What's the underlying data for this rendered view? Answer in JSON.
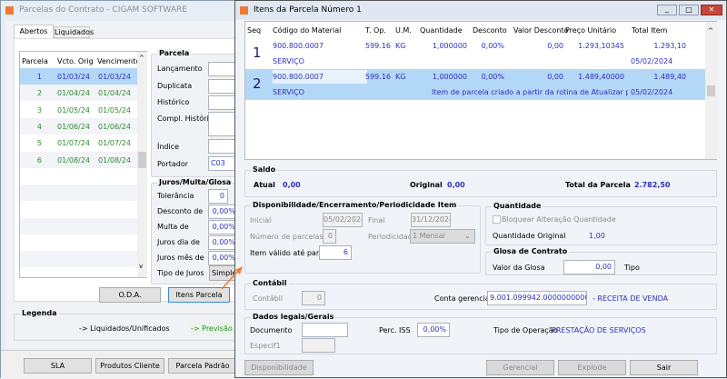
{
  "left_window": {
    "title": "Parcelas do Contrato - CIGAM SOFTWARE CORPORATIVO LTDA",
    "tabs": [
      "Abertos",
      "Liquidados"
    ],
    "table": {
      "headers": [
        "Parcela",
        "Vcto. Orig",
        "Vencimento"
      ],
      "rows": [
        [
          "1",
          "01/03/24",
          "01/03/24"
        ],
        [
          "2",
          "01/04/24",
          "01/04/24"
        ],
        [
          "3",
          "01/05/24",
          "01/05/24"
        ],
        [
          "4",
          "01/06/24",
          "01/06/24"
        ],
        [
          "5",
          "01/07/24",
          "01/07/24"
        ],
        [
          "6",
          "01/08/24",
          "01/08/24"
        ]
      ]
    },
    "parcela": {
      "title": "Parcela",
      "lancamento": "Lançamento",
      "duplicata": "Duplicata",
      "historico": "Histórico",
      "compl_historico": "Compl. Histórico",
      "indice": "Índice",
      "portador": "Portador",
      "portador_value": "C03"
    },
    "juros": {
      "title": "Juros/Multa/Glosa",
      "tolerancia": "Tolerância",
      "tolerancia_value": "0",
      "desconto": "Desconto de",
      "desconto_value": "0,00%",
      "multa": "Multa de",
      "multa_value": "0,00%",
      "juros_dia": "Juros dia de",
      "juros_dia_value": "0,00%",
      "juros_mes": "Juros mês de",
      "juros_mes_value": "0,00%",
      "tipo_juros": "Tipo de Juros",
      "tipo_juros_value": "Simples"
    },
    "oda_button": "O.D.A.",
    "itens_parcela_button": "Itens Parcela",
    "legenda": {
      "title": "Legenda",
      "liquidados": "-> Liquidados/Unificados",
      "previsao": "-> Previsão"
    },
    "bottom_buttons": [
      "SLA",
      "Produtos Cliente",
      "Parcela Padrão"
    ]
  },
  "right_window": {
    "title": "Itens da Parcela Número 1",
    "grid": {
      "headers": [
        "Seq",
        "Código do Material",
        "T. Op.",
        "U.M.",
        "Quantidade",
        "Desconto",
        "Valor Desconto",
        "Preço Unitário",
        "Total Item"
      ],
      "rows": [
        {
          "seq": "1",
          "codigo": "900.800.0007",
          "top": "599.16",
          "um": "KG",
          "quantidade": "1,000000",
          "desconto": "0,00%",
          "valor_desconto": "0,00",
          "preco": "1.293,10345",
          "total": "1.293,10",
          "descricao": "SERVIÇO",
          "obs": "",
          "data": "05/02/2024"
        },
        {
          "seq": "2",
          "codigo": "900.800.0007",
          "top": "599.16",
          "um": "KG",
          "quantidade": "1,000000",
          "desconto": "0,00%",
          "valor_desconto": "0,00",
          "preco": "1.489,40000",
          "total": "1.489,40",
          "descricao": "SERVIÇO",
          "obs": "Item de parcela criado a partir da rotina de Atualizar parcelas de Cor",
          "data": "05/02/2024"
        }
      ]
    },
    "saldo": {
      "title": "Saldo",
      "atual": "Atual",
      "atual_value": "0,00",
      "original": "Original",
      "original_value": "0,00",
      "total": "Total da Parcela",
      "total_value": "2.782,50"
    },
    "disp": {
      "title": "Disponibilidade/Encerramento/Periodicidade Item",
      "inicial": "Inicial",
      "inicial_value": "05/02/2024",
      "final": "Final",
      "final_value": "31/12/2024",
      "num_parcelas": "Número de parcelas",
      "num_parcelas_value": "0",
      "periodicidade": "Periodicidade",
      "periodicidade_value": "1 Mensal",
      "valido": "Item válido até parcela",
      "valido_value": "6"
    },
    "quantidade": {
      "title": "Quantidade",
      "bloquear": "Bloquear Alteração Quantidade",
      "original": "Quantidade Original",
      "original_value": "1,00"
    },
    "glosa": {
      "title": "Glosa de Contrato",
      "valor": "Valor da Glosa",
      "valor_value": "0,00",
      "tipo": "Tipo"
    },
    "contabil": {
      "title": "Contábil",
      "contabil": "Contábil",
      "contabil_value": "0",
      "conta": "Conta gerencial",
      "conta_value": "9.001.099942.0000000000",
      "conta_desc": "- RECEITA DE VENDA"
    },
    "dados": {
      "title": "Dados legais/Gerais",
      "documento": "Documento",
      "documento_value": "",
      "iss": "Perc. ISS",
      "iss_value": "0,00%",
      "tipo_op": "Tipo de Operação",
      "tipo_op_value": "PRESTAÇÃO DE SERVIÇOS",
      "especif": "Especif1"
    },
    "buttons": {
      "disponibilidade": "Disponibilidade",
      "gerencial": "Gerencial",
      "explode": "Explode",
      "sair": "Sair"
    }
  },
  "colors": {
    "accent_text": "#2f2fbf",
    "green_text": "#2e8b2e",
    "selection": "#b3d7f7",
    "arrow": "#f07a32"
  }
}
